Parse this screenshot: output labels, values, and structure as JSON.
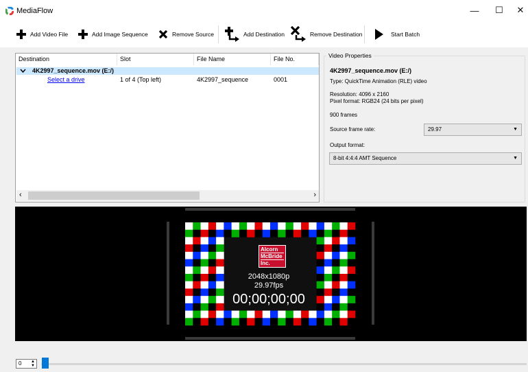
{
  "window": {
    "title": "MediaFlow"
  },
  "toolbar": {
    "add_video_file": "Add Video File",
    "add_image_sequence": "Add Image Sequence",
    "remove_source": "Remove Source",
    "add_destination": "Add Destination",
    "remove_destination": "Remove Destination",
    "start_batch": "Start Batch"
  },
  "tree": {
    "columns": [
      "Destination",
      "Slot",
      "File Name",
      "File No."
    ],
    "source_name": "4K2997_sequence.mov (E:/)",
    "row": {
      "destination": "Select a drive",
      "slot": "1 of 4 (Top left)",
      "file_name": "4K2997_sequence",
      "file_no": "0001"
    }
  },
  "video_properties": {
    "legend": "Video Properties",
    "file": "4K2997_sequence.mov (E:/)",
    "type": "Type: QuickTime Animation (RLE) video",
    "resolution": "Resolution: 4096 x 2160",
    "pixel_format": "Pixel format: RGB24 (24 bits per pixel)",
    "frames": "900 frames",
    "source_frame_rate_label": "Source frame rate:",
    "source_frame_rate_value": "29.97",
    "output_format_label": "Output format:",
    "output_format_value": "8-bit 4:4:4 AMT Sequence"
  },
  "preview": {
    "logo_lines": [
      "Alcorn",
      "McBride",
      "Inc."
    ],
    "resolution": "2048x1080p",
    "fps": "29.97fps",
    "timecode": "00;00;00;00"
  },
  "timeline": {
    "frame_value": "0",
    "position_fraction": 0.0
  },
  "colors": {
    "accent": "#0078d7",
    "row_selected": "#cce8ff",
    "logo_red": "#c8102e"
  }
}
